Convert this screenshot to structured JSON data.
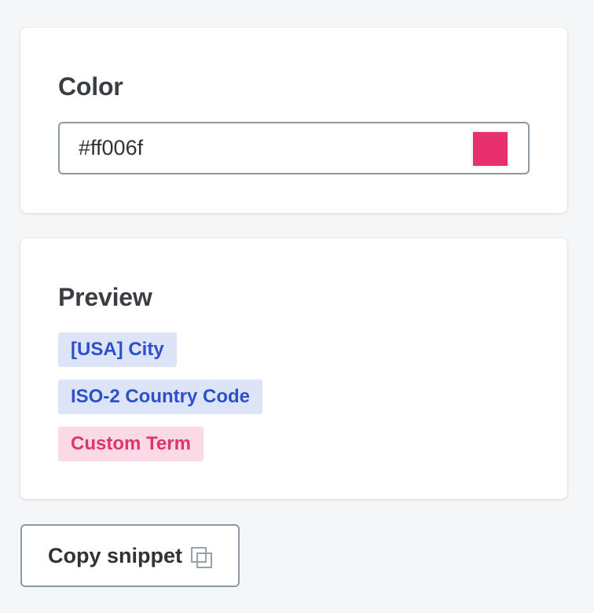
{
  "color_card": {
    "title": "Color",
    "input_value": "#ff006f",
    "swatch_color": "#e9306f"
  },
  "preview_card": {
    "title": "Preview",
    "chips": [
      {
        "label": "[USA] City",
        "variant": "blue"
      },
      {
        "label": "ISO-2 Country Code",
        "variant": "blue"
      },
      {
        "label": "Custom Term",
        "variant": "pink"
      }
    ]
  },
  "copy_button": {
    "label": "Copy snippet",
    "icon": "copy-icon"
  },
  "colors": {
    "chip_blue_bg": "#dde4f8",
    "chip_blue_text": "#2c50c8",
    "chip_pink_bg": "#fcd9e6",
    "chip_pink_text": "#e0346d",
    "border": "#8d9aa6"
  }
}
